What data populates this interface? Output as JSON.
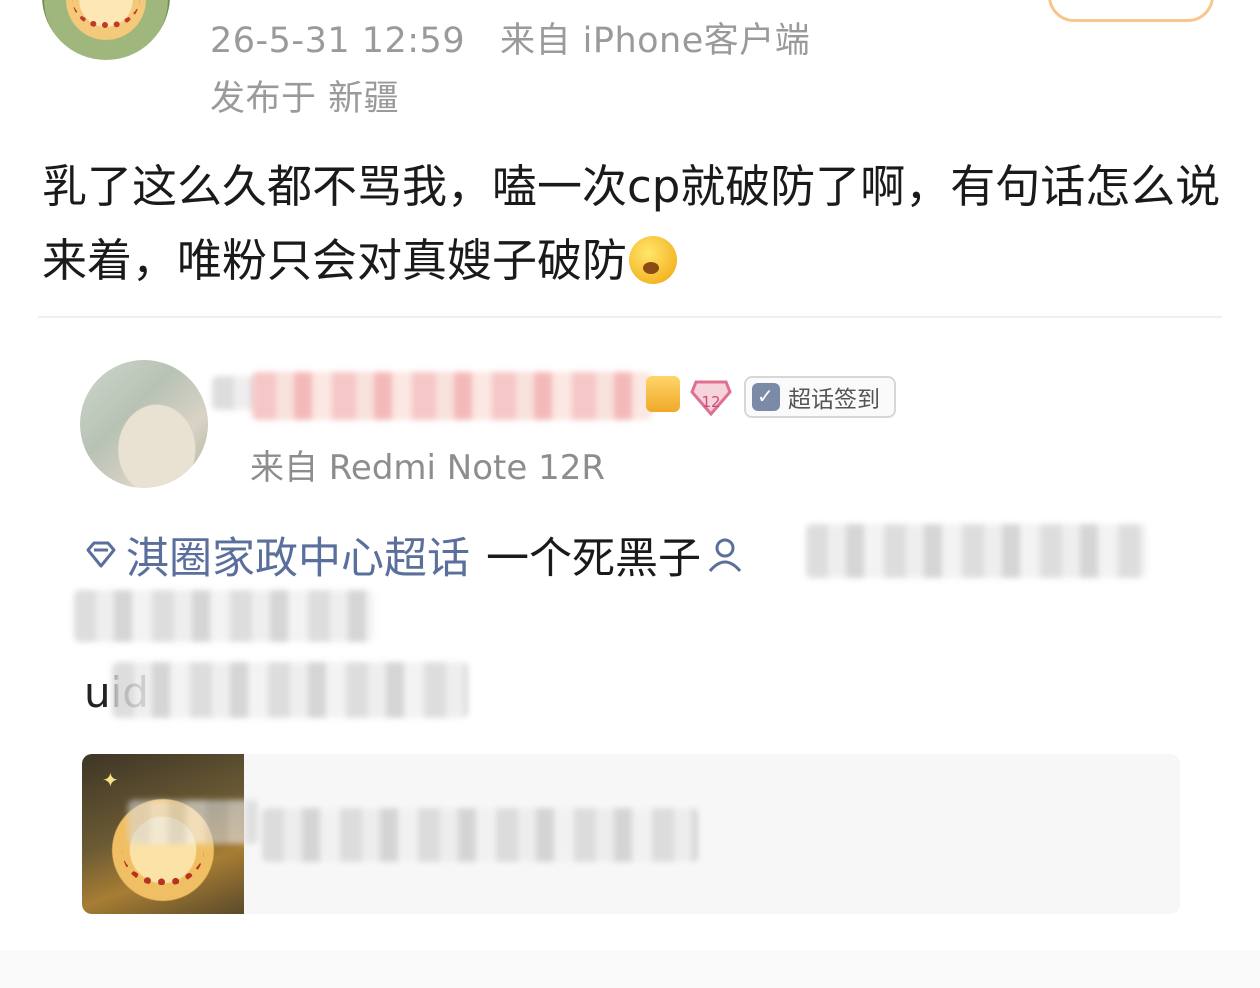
{
  "post": {
    "timestamp": "26-5-31 12:59",
    "source": "来自 iPhone客户端",
    "location": "发布于 新疆",
    "text": "乳了这么久都不骂我，嗑一次cp就破防了啊，有句话怎么说来着，唯粉只会对真嫂子破防"
  },
  "embedded": {
    "badge_label": "超话签到",
    "level": "12",
    "source": "来自 Redmi Note 12R",
    "topic": "淇圈家政中心超话",
    "text_after_topic": "一个死黑子",
    "uid_prefix": "uid"
  },
  "icons": {
    "emoji": "yawn-emoji",
    "topic": "diamond-icon",
    "mention": "person-icon",
    "checkin": "calendar-check-icon"
  },
  "colors": {
    "meta": "#9a9a9a",
    "topic": "#5b6f9c",
    "text": "#1a1a1a"
  }
}
